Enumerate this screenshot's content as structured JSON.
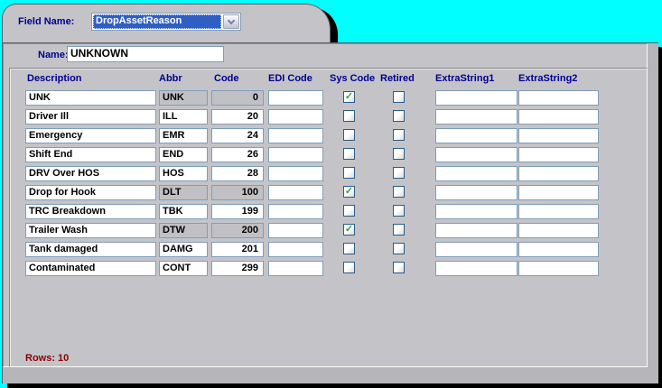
{
  "window": {
    "field_name_label": "Field Name:",
    "field_name_value": "DropAssetReason",
    "name_label": "Name:",
    "name_value": "UNKNOWN",
    "rows_count_label": "Rows: 10"
  },
  "table": {
    "columns": [
      "Description",
      "Abbr",
      "Code",
      "EDI Code",
      "Sys Code",
      "Retired",
      "ExtraString1",
      "ExtraString2"
    ],
    "rows": [
      {
        "description": "UNK",
        "abbr": "UNK",
        "code": "0",
        "edi_code": "",
        "sys_code": true,
        "retired": false,
        "extra_string1": "",
        "extra_string2": "",
        "locked": true
      },
      {
        "description": "Driver Ill",
        "abbr": "ILL",
        "code": "20",
        "edi_code": "",
        "sys_code": false,
        "retired": false,
        "extra_string1": "",
        "extra_string2": "",
        "locked": false
      },
      {
        "description": "Emergency",
        "abbr": "EMR",
        "code": "24",
        "edi_code": "",
        "sys_code": false,
        "retired": false,
        "extra_string1": "",
        "extra_string2": "",
        "locked": false
      },
      {
        "description": "Shift End",
        "abbr": "END",
        "code": "26",
        "edi_code": "",
        "sys_code": false,
        "retired": false,
        "extra_string1": "",
        "extra_string2": "",
        "locked": false
      },
      {
        "description": "DRV Over HOS",
        "abbr": "HOS",
        "code": "28",
        "edi_code": "",
        "sys_code": false,
        "retired": false,
        "extra_string1": "",
        "extra_string2": "",
        "locked": false
      },
      {
        "description": "Drop for Hook",
        "abbr": "DLT",
        "code": "100",
        "edi_code": "",
        "sys_code": true,
        "retired": false,
        "extra_string1": "",
        "extra_string2": "",
        "locked": true
      },
      {
        "description": "TRC Breakdown",
        "abbr": "TBK",
        "code": "199",
        "edi_code": "",
        "sys_code": false,
        "retired": false,
        "extra_string1": "",
        "extra_string2": "",
        "locked": false
      },
      {
        "description": "Trailer Wash",
        "abbr": "DTW",
        "code": "200",
        "edi_code": "",
        "sys_code": true,
        "retired": false,
        "extra_string1": "",
        "extra_string2": "",
        "locked": true
      },
      {
        "description": "Tank damaged",
        "abbr": "DAMG",
        "code": "201",
        "edi_code": "",
        "sys_code": false,
        "retired": false,
        "extra_string1": "",
        "extra_string2": "",
        "locked": false
      },
      {
        "description": "Contaminated",
        "abbr": "CONT",
        "code": "299",
        "edi_code": "",
        "sys_code": false,
        "retired": false,
        "extra_string1": "",
        "extra_string2": "",
        "locked": false
      }
    ]
  },
  "icons": {
    "check_glyph": "✓"
  },
  "colors": {
    "background": "#00ffff",
    "panel": "#c4c4c8",
    "label": "#000090",
    "rows_label": "#8b0000",
    "selection_blue": "#2f5fc4",
    "check_green": "#2f9e44",
    "field_border": "#7f9db9"
  }
}
